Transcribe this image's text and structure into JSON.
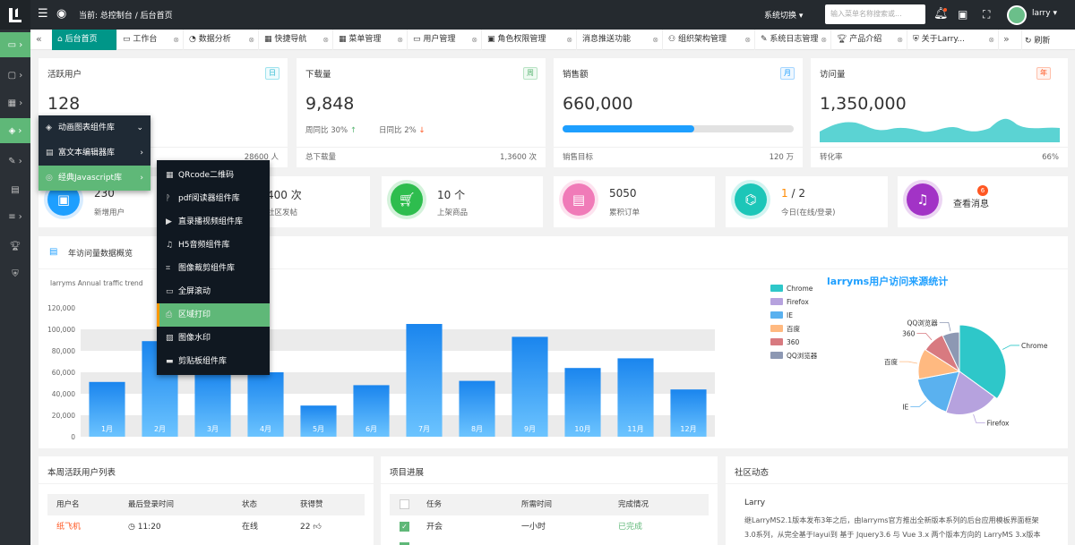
{
  "header": {
    "breadcrumb": "当前: 总控制台 / 后台首页",
    "system_switch": "系统切换",
    "search_placeholder": "输入菜单名称搜索或...",
    "user_name": "larry"
  },
  "tabs": [
    {
      "label": "后台首页"
    },
    {
      "label": "工作台"
    },
    {
      "label": "数据分析"
    },
    {
      "label": "快捷导航"
    },
    {
      "label": "菜单管理"
    },
    {
      "label": "用户管理"
    },
    {
      "label": "角色权限管理"
    },
    {
      "label": "消息推送功能"
    },
    {
      "label": "组织架构管理"
    },
    {
      "label": "系统日志管理"
    },
    {
      "label": "产品介绍"
    },
    {
      "label": "关于Larry..."
    }
  ],
  "refresh_label": "刷新",
  "cards": [
    {
      "title": "活跃用户",
      "tag": "日",
      "value": "128",
      "foot_right": "28600 人"
    },
    {
      "title": "下载量",
      "tag": "周",
      "value": "9,848",
      "week": "周同比 30%",
      "day": "日同比 2%",
      "foot_left": "总下载量",
      "foot_right": "1,3600 次"
    },
    {
      "title": "销售额",
      "tag": "月",
      "value": "660,000",
      "progress": 0.57,
      "foot_left": "销售目标",
      "foot_right": "120 万"
    },
    {
      "title": "访问量",
      "tag": "年",
      "value": "1,350,000",
      "foot_left": "转化率",
      "foot_right": "66%"
    }
  ],
  "stats": [
    {
      "value": "230",
      "label": "新增用户"
    },
    {
      "value": "400 次",
      "label": "社区发帖"
    },
    {
      "value": "10 个",
      "label": "上架商品"
    },
    {
      "value": "5050",
      "label": "累积订单"
    },
    {
      "value_a": "1",
      "value_b": "/ 2",
      "label": "今日(在线/登录)"
    },
    {
      "label": "查看消息",
      "badge": "6"
    }
  ],
  "chart_section_title": "年访问量数据概览",
  "menu1": [
    {
      "label": "动画图表组件库"
    },
    {
      "label": "富文本编辑器库"
    },
    {
      "label": "经典Javascript库"
    }
  ],
  "menu2": [
    {
      "label": "QRcode二维码"
    },
    {
      "label": "pdf阅读器组件库"
    },
    {
      "label": "直录播视频组件库"
    },
    {
      "label": "H5音频组件库"
    },
    {
      "label": "图像裁剪组件库"
    },
    {
      "label": "全屏滚动"
    },
    {
      "label": "区域打印"
    },
    {
      "label": "图像水印"
    },
    {
      "label": "剪贴板组件库"
    }
  ],
  "chart_data": [
    {
      "type": "bar",
      "title": "larryms Annual traffic trend",
      "categories": [
        "1月",
        "2月",
        "3月",
        "4月",
        "5月",
        "6月",
        "7月",
        "8月",
        "9月",
        "10月",
        "11月",
        "12月"
      ],
      "values": [
        51000,
        89000,
        61000,
        60000,
        29000,
        48000,
        105000,
        52000,
        93000,
        64000,
        73000,
        44000
      ],
      "ylim": [
        0,
        120000
      ],
      "yticks": [
        "0",
        "20,000",
        "40,000",
        "60,000",
        "80,000",
        "100,000",
        "120,000"
      ],
      "color": "#2f8df0"
    },
    {
      "type": "pie",
      "title": "larryms用户访问来源统计",
      "legend": "left",
      "slices": [
        {
          "name": "Chrome",
          "value": 35,
          "color": "#2ec7c9"
        },
        {
          "name": "Firefox",
          "value": 20,
          "color": "#b6a2de"
        },
        {
          "name": "IE",
          "value": 17,
          "color": "#5ab1ef"
        },
        {
          "name": "百度",
          "value": 12,
          "color": "#ffb980"
        },
        {
          "name": "360",
          "value": 9,
          "color": "#d87a80"
        },
        {
          "name": "QQ浏览器",
          "value": 7,
          "color": "#8d98b3"
        }
      ]
    }
  ],
  "active_users": {
    "title": "本周活跃用户列表",
    "columns": [
      "用户名",
      "最后登录时间",
      "状态",
      "获得赞"
    ],
    "rows": [
      {
        "name": "纸飞机",
        "time": "11:20",
        "status": "在线",
        "likes": "22"
      }
    ]
  },
  "progress": {
    "title": "项目进展",
    "columns": [
      "任务",
      "所需时间",
      "完成情况"
    ],
    "rows": [
      {
        "task": "开会",
        "time": "一小时",
        "status": "已完成"
      }
    ]
  },
  "community": {
    "title": "社区动态",
    "author": "Larry",
    "text": "继LarryMS2.1版本发布3年之后，由larryms官方推出全新版本系列的后台应用模板界面框架3.0系列，从完全基于layui到 基于 Jquery3.6 与 Vue 3.x 两个版本方向的 LarryMS 3.x版本"
  }
}
